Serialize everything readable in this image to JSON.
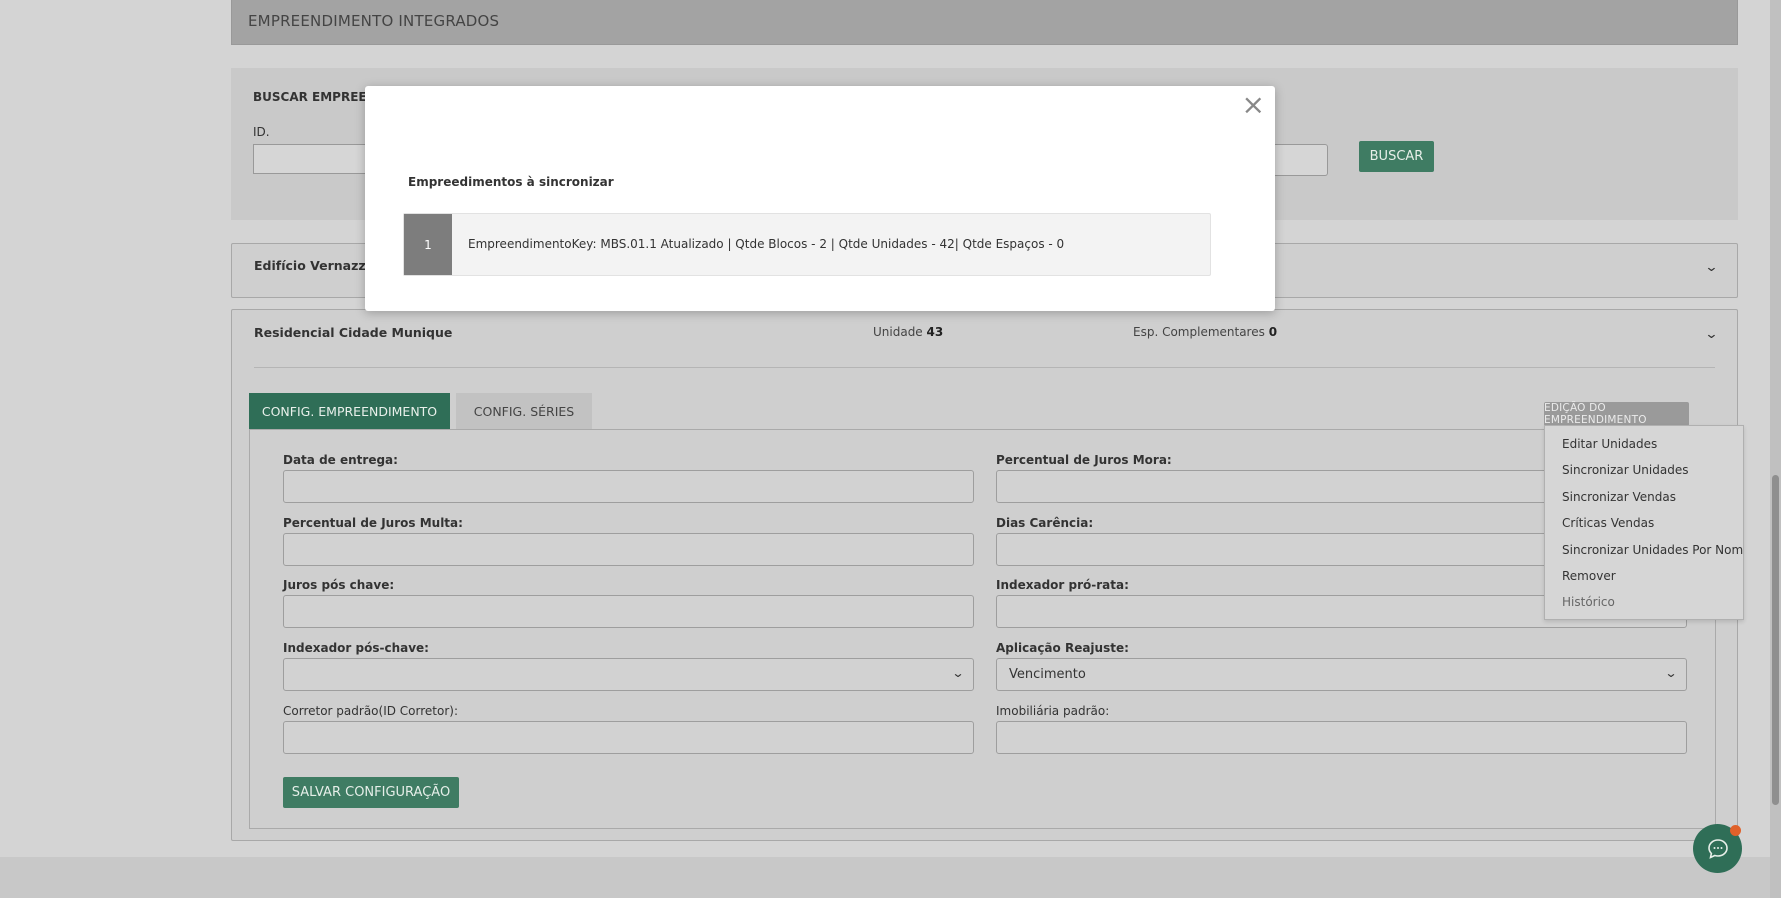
{
  "header": {
    "title": "EMPREENDIMENTO INTEGRADOS"
  },
  "search": {
    "title": "BUSCAR EMPREEN",
    "id_label": "ID.",
    "id_value": "",
    "button_label": "BUSCAR"
  },
  "accordion": {
    "items": [
      {
        "title": "Edifício Vernazza"
      },
      {
        "title": "Residencial Cidade Munique",
        "unit_label": "Unidade",
        "unit_value": "43",
        "esp_label": "Esp. Complementares",
        "esp_value": "0"
      }
    ]
  },
  "tabs": [
    {
      "label": "CONFIG. EMPREENDIMENTO",
      "active": true
    },
    {
      "label": "CONFIG. SÉRIES",
      "active": false
    }
  ],
  "edit_button": {
    "label": "EDIÇÃO DO EMPREENDIMENTO"
  },
  "edit_menu": {
    "items": [
      "Editar Unidades",
      "Sincronizar Unidades",
      "Sincronizar Vendas",
      "Críticas Vendas",
      "Sincronizar Unidades Por Nome",
      "Remover",
      "Histórico"
    ]
  },
  "form": {
    "data_entrega": {
      "label": "Data de entrega:",
      "value": ""
    },
    "juros_mora": {
      "label": "Percentual de Juros Mora:",
      "value": ""
    },
    "juros_multa": {
      "label": "Percentual de Juros Multa:",
      "value": ""
    },
    "dias_carencia": {
      "label": "Dias Carência:",
      "value": ""
    },
    "juros_pos_chave": {
      "label": "Juros pós chave:",
      "value": ""
    },
    "indexador_pro_rata": {
      "label": "Indexador pró-rata:",
      "value": ""
    },
    "indexador_pos_chave": {
      "label": "Indexador pós-chave:",
      "value": ""
    },
    "aplicacao_reajuste": {
      "label": "Aplicação Reajuste:",
      "value": "Vencimento"
    },
    "corretor_padrao": {
      "label": "Corretor padrão(ID Corretor):",
      "value": ""
    },
    "imobiliaria_padrao": {
      "label": "Imobiliária padrão:",
      "value": ""
    },
    "save_label": "SALVAR CONFIGURAÇÃO"
  },
  "modal": {
    "close_glyph": "×",
    "heading": "Empreedimentos à sincronizar",
    "rows": [
      {
        "index": "1",
        "text": "EmpreendimentoKey: MBS.01.1 Atualizado | Qtde Blocos - 2 | Qtde Unidades - 42| Qtde Espaços - 0"
      }
    ]
  },
  "colors": {
    "primary": "#2f6e57",
    "button": "#3f7c63",
    "notification": "#e0612a"
  },
  "icons": {
    "chat": "chat-bubble-icon",
    "chevron": "chevron-down-icon",
    "close": "close-icon"
  }
}
